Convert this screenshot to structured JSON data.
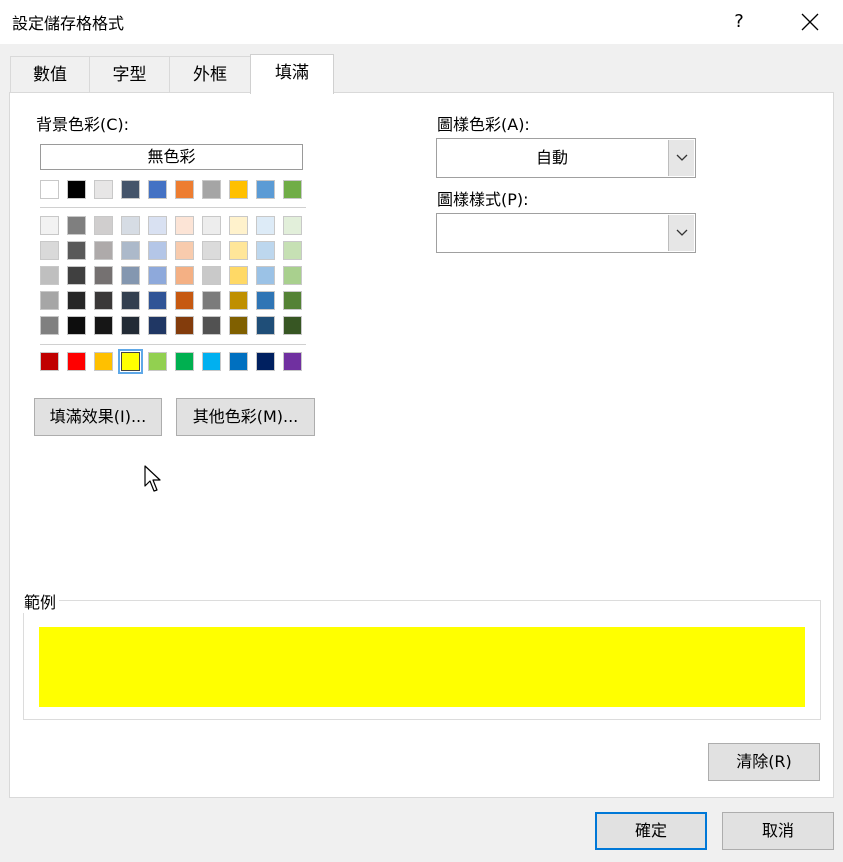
{
  "window": {
    "title": "設定儲存格格式",
    "help_label": "?"
  },
  "tabs": [
    {
      "label": "數值",
      "active": false
    },
    {
      "label": "字型",
      "active": false
    },
    {
      "label": "外框",
      "active": false
    },
    {
      "label": "填滿",
      "active": true
    }
  ],
  "background_color": {
    "label": "背景色彩(C):",
    "no_color_label": "無色彩",
    "theme_row": [
      "#ffffff",
      "#000000",
      "#e7e6e6",
      "#44546a",
      "#4472c4",
      "#ed7d31",
      "#a5a5a5",
      "#ffc000",
      "#5b9bd5",
      "#70ad47"
    ],
    "tint_rows": [
      [
        "#f2f2f2",
        "#7f7f7f",
        "#d0cece",
        "#d6dce4",
        "#d9e1f2",
        "#fce4d6",
        "#ededed",
        "#fff2cc",
        "#ddebf7",
        "#e2efda"
      ],
      [
        "#d9d9d9",
        "#595959",
        "#aeaaaa",
        "#acb9ca",
        "#b4c6e7",
        "#f8cbad",
        "#dbdbdb",
        "#ffe699",
        "#bdd7ee",
        "#c6e0b4"
      ],
      [
        "#bfbfbf",
        "#404040",
        "#757171",
        "#8497b0",
        "#8ea9db",
        "#f4b084",
        "#c9c9c9",
        "#ffd966",
        "#9bc2e6",
        "#a9d08e"
      ],
      [
        "#a6a6a6",
        "#262626",
        "#3a3838",
        "#333f4f",
        "#305496",
        "#c65911",
        "#7b7b7b",
        "#bf8f00",
        "#2f75b5",
        "#548235"
      ],
      [
        "#808080",
        "#0d0d0d",
        "#161616",
        "#222b35",
        "#203764",
        "#833c0c",
        "#525252",
        "#806000",
        "#1f4e78",
        "#375623"
      ]
    ],
    "standard_row": [
      "#c00000",
      "#ff0000",
      "#ffc000",
      "#ffff00",
      "#92d050",
      "#00b050",
      "#00b0f0",
      "#0070c0",
      "#002060",
      "#7030a0"
    ],
    "selected_color": "#ffff00",
    "fill_effects_label": "填滿效果(I)...",
    "more_colors_label": "其他色彩(M)..."
  },
  "pattern_color": {
    "label": "圖樣色彩(A):",
    "value": "自動"
  },
  "pattern_style": {
    "label": "圖樣樣式(P):",
    "value": ""
  },
  "sample": {
    "label": "範例",
    "color": "#ffff00"
  },
  "buttons": {
    "clear": "清除(R)",
    "ok": "確定",
    "cancel": "取消"
  },
  "colors": {
    "accent": "#0078d7",
    "selection": "#5ea8e8"
  },
  "icons": {
    "close": "close-icon",
    "dropdown": "chevron-down-icon",
    "cursor": "mouse-pointer-icon"
  }
}
